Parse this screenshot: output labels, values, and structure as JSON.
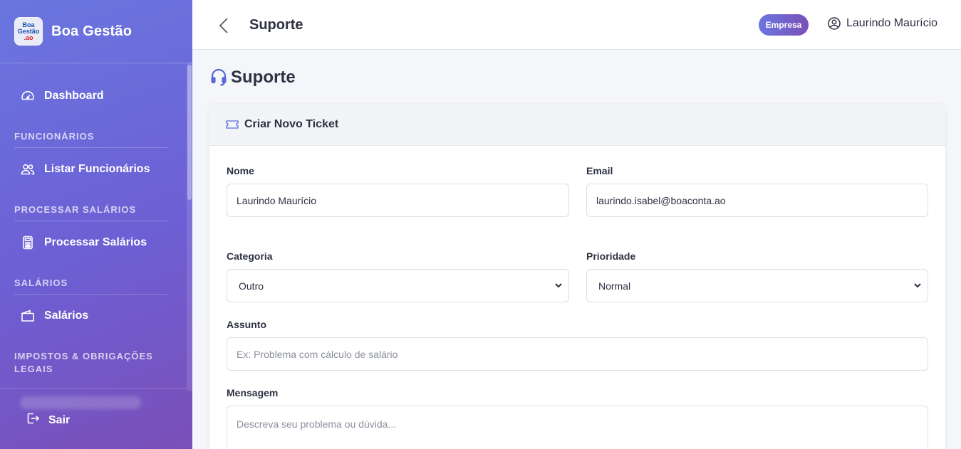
{
  "brand": {
    "name": "Boa Gestão",
    "logo_text_top": "Boa Gestão",
    "logo_text_bottom": ".ao"
  },
  "sidebar": {
    "items": [
      {
        "label": "Dashboard",
        "icon": "speedometer-icon"
      },
      {
        "label": "Listar Funcionários",
        "icon": "users-icon"
      },
      {
        "label": "Processar Salários",
        "icon": "calculator-icon"
      },
      {
        "label": "Salários",
        "icon": "wallet-icon"
      }
    ],
    "sections": [
      "FUNCIONÁRIOS",
      "PROCESSAR SALÁRIOS",
      "SALÁRIOS",
      "IMPOSTOS & OBRIGAÇÕES LEGAIS"
    ],
    "logout_label": "Sair"
  },
  "header": {
    "title": "Suporte",
    "badge": "Empresa",
    "user_name": "Laurindo Maurício"
  },
  "main": {
    "page_title": "Suporte"
  },
  "form": {
    "card_title": "Criar Novo Ticket",
    "name_label": "Nome",
    "name_value": "Laurindo Maurício",
    "email_label": "Email",
    "email_value": "laurindo.isabel@boaconta.ao",
    "category_label": "Categoria",
    "category_value": "Outro",
    "priority_label": "Prioridade",
    "priority_value": "Normal",
    "subject_label": "Assunto",
    "subject_placeholder": "Ex: Problema com cálculo de salário",
    "message_label": "Mensagem",
    "message_placeholder": "Descreva seu problema ou dúvida..."
  },
  "colors": {
    "accent_start": "#6a76e0",
    "accent_end": "#7a4fb8",
    "icon_blue": "#5b6bd6"
  }
}
